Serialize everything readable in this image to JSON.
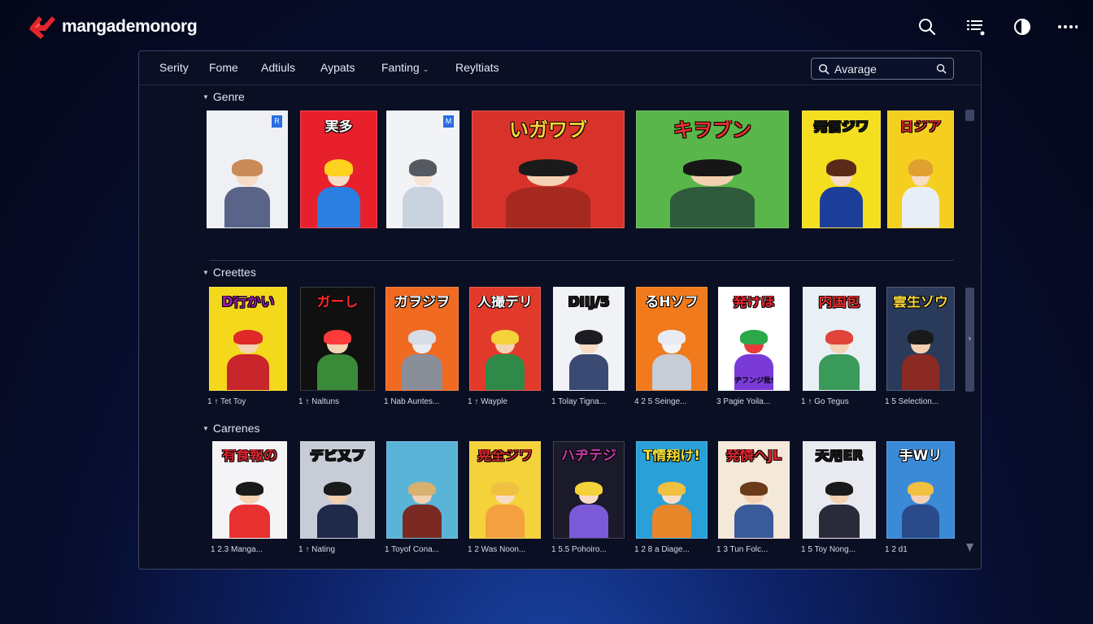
{
  "app": {
    "name": "mangademonorg",
    "logo_icon": "demon-logo-icon",
    "accent_color": "#e0262c"
  },
  "top_icons": [
    {
      "name": "search-icon"
    },
    {
      "name": "list-icon"
    },
    {
      "name": "contrast-icon"
    },
    {
      "name": "more-icon"
    }
  ],
  "nav": {
    "items": [
      {
        "label": "Serity"
      },
      {
        "label": "Fome"
      },
      {
        "label": "Adtiuls"
      },
      {
        "label": "Aypats"
      },
      {
        "label": "Fanting",
        "caret": "⌄"
      },
      {
        "label": "Reyltiats"
      }
    ],
    "search": {
      "value": "",
      "placeholder": "Avarage"
    }
  },
  "sections": [
    {
      "title": "Genre",
      "covers": [
        {
          "title": "",
          "tag": "R",
          "bg": "#eef0f4",
          "hair": "#c98a58",
          "skin": "#f6dcc4",
          "body": "#5a6488",
          "fg": "#223"
        },
        {
          "title": "実多",
          "bg": "#e8202c",
          "hair": "#ffd21f",
          "skin": "#f6dcc4",
          "body": "#2a7fe0",
          "fg": "#ffffff"
        },
        {
          "title": "",
          "tag": "M",
          "bg": "#f2f3f6",
          "hair": "#555a62",
          "skin": "#f6e4d4",
          "body": "#c9d3e0",
          "fg": "#223"
        },
        {
          "title": "いガワブ",
          "bg": "#d8332a",
          "hair": "#1a1a1a",
          "skin": "#f6d2b4",
          "body": "#a5291f",
          "fg": "#ffd23a"
        },
        {
          "title": "キヲブン",
          "bg": "#58b64a",
          "hair": "#161616",
          "skin": "#f2d0b0",
          "body": "#2f5a3c",
          "fg": "#e83030"
        },
        {
          "title": "発信ジワ",
          "bg": "#f4de20",
          "hair": "#5a2a18",
          "skin": "#f8dcc6",
          "body": "#1d3f9a",
          "fg": "#1a1a1a"
        },
        {
          "title": "日ジア",
          "bg": "#f4cf20",
          "hair": "#e0a030",
          "skin": "#f8dcc6",
          "body": "#e8eef6",
          "fg": "#d8262e"
        }
      ]
    },
    {
      "title": "Creettes",
      "covers": [
        {
          "title": "D行かい",
          "bg": "#f4d81c",
          "hair": "#e02828",
          "skin": "#f6d2b4",
          "body": "#c8262a",
          "fg": "#9a1aa8",
          "caption": "1 ↑   Tet Toy"
        },
        {
          "title": "ガーし",
          "bg": "#101010",
          "hair": "#ff3a3a",
          "skin": "#f6d2b4",
          "body": "#3a8a3a",
          "fg": "#ff2a2a",
          "caption": "1 ↑   Naltuns"
        },
        {
          "title": "ガヲジヲ",
          "bg": "#f06a22",
          "hair": "#d8dce4",
          "skin": "#e8ecf2",
          "body": "#8a8e98",
          "fg": "#ffffff",
          "caption": "1 Nab Auntes..."
        },
        {
          "title": "人撮デリ",
          "bg": "#e23a2a",
          "hair": "#f4d23a",
          "skin": "#f6d2b4",
          "body": "#2f8a4a",
          "fg": "#ffffff",
          "caption": "1 ↑   Wayple"
        },
        {
          "title": "DIIJ/5",
          "bg": "#f0f2f6",
          "hair": "#1c1c22",
          "skin": "#f6dcc4",
          "body": "#3a4a72",
          "fg": "#1a1a1a",
          "caption": "1 Tolay Tigna..."
        },
        {
          "title": "るHソフ",
          "bg": "#f07a1c",
          "hair": "#e8ecf2",
          "skin": "#f2f4f8",
          "body": "#c8ccd6",
          "fg": "#ffffff",
          "caption": "4 2 5 Seinge..."
        },
        {
          "title": "発けほ",
          "bg": "#ffffff",
          "hair": "#2aa84a",
          "skin": "#e83a3a",
          "body": "#7a3ad8",
          "fg": "#e8262e",
          "foot": "ヂフンジ批!",
          "caption": "3 Pagie Yoila..."
        },
        {
          "title": "内国包",
          "bg": "#e8f0f6",
          "hair": "#e0443a",
          "skin": "#f6d2b4",
          "body": "#3a9a5a",
          "fg": "#e83030",
          "caption": "1 ↑   Go Tegus"
        },
        {
          "title": "雲生ゾウ",
          "bg": "#2a3a5a",
          "hair": "#1a1a1a",
          "skin": "#f2d0b0",
          "body": "#8a2a22",
          "fg": "#f4d23a",
          "caption": "1 5 Selection..."
        }
      ]
    },
    {
      "title": "Carrenes",
      "covers": [
        {
          "title": "有食報の",
          "bg": "#f4f4f6",
          "hair": "#1a1a1a",
          "skin": "#f6d2b4",
          "body": "#e83030",
          "fg": "#d8262e",
          "caption": "1 2.3  Manga..."
        },
        {
          "title": "デビ又ブ",
          "bg": "#c8ccd6",
          "hair": "#1a1a1a",
          "skin": "#f2d0b0",
          "body": "#1f2a4a",
          "fg": "#1a1a1a",
          "caption": "1 ↑   Nating"
        },
        {
          "title": "",
          "bg": "#5ab4d8",
          "hair": "#d8b070",
          "skin": "#f2d0b0",
          "body": "#7a2a22",
          "fg": "#ffffff",
          "caption": "1 Toyof Cona..."
        },
        {
          "title": "晃全ジワ",
          "bg": "#f4d23a",
          "hair": "#f0c040",
          "skin": "#f8dcc6",
          "body": "#f4a040",
          "fg": "#d8262e",
          "caption": "1 2 Was Noon..."
        },
        {
          "title": "ハヂテジ",
          "bg": "#1a1a2a",
          "hair": "#f4d23a",
          "skin": "#f8dcc6",
          "body": "#7a5ad8",
          "fg": "#c83aa8",
          "caption": "1 5.5 Pohoiro..."
        },
        {
          "title": "T情翔け!",
          "bg": "#2aa0d8",
          "hair": "#f0c040",
          "skin": "#f8dcc6",
          "body": "#e8862a",
          "fg": "#f4e23a",
          "caption": "1 2 8 a Diage..."
        },
        {
          "title": "発憐ヘJL",
          "bg": "#f4e8d8",
          "hair": "#6a3a1a",
          "skin": "#f6d2b4",
          "body": "#3a5a9a",
          "fg": "#d8262e",
          "caption": "1 3  Tun Folc..."
        },
        {
          "title": "天用ER",
          "bg": "#e8eaf0",
          "hair": "#1a1a1a",
          "skin": "#f2d0b0",
          "body": "#2a2a3a",
          "fg": "#1a1a1a",
          "caption": "1 5  Toy Nong..."
        },
        {
          "title": "手Wリ",
          "bg": "#3a8ad8",
          "hair": "#f0c040",
          "skin": "#f6d2b4",
          "body": "#2a4a8a",
          "fg": "#ffffff",
          "caption": "1 2 d1"
        }
      ]
    }
  ]
}
